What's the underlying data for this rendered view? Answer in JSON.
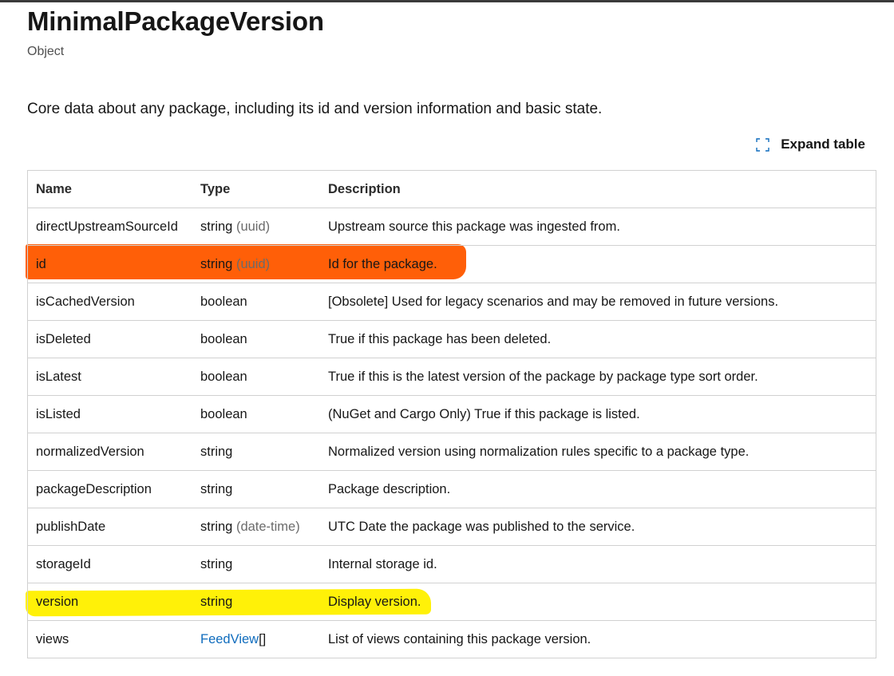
{
  "header": {
    "title": "MinimalPackageVersion",
    "kind": "Object",
    "summary": "Core data about any package, including its id and version information and basic state."
  },
  "toolbar": {
    "expand_label": "Expand table",
    "expand_icon": "expand-icon"
  },
  "table": {
    "columns": [
      "Name",
      "Type",
      "Description"
    ],
    "rows": [
      {
        "name": "directUpstreamSourceId",
        "type": "string",
        "format": "(uuid)",
        "type_is_link": false,
        "description": "Upstream source this package was ingested from."
      },
      {
        "name": "id",
        "type": "string",
        "format": "(uuid)",
        "type_is_link": false,
        "description": "Id for the package.",
        "highlight": "orange"
      },
      {
        "name": "isCachedVersion",
        "type": "boolean",
        "format": "",
        "type_is_link": false,
        "description": "[Obsolete] Used for legacy scenarios and may be removed in future versions."
      },
      {
        "name": "isDeleted",
        "type": "boolean",
        "format": "",
        "type_is_link": false,
        "description": "True if this package has been deleted."
      },
      {
        "name": "isLatest",
        "type": "boolean",
        "format": "",
        "type_is_link": false,
        "description": "True if this is the latest version of the package by package type sort order."
      },
      {
        "name": "isListed",
        "type": "boolean",
        "format": "",
        "type_is_link": false,
        "description": "(NuGet and Cargo Only) True if this package is listed."
      },
      {
        "name": "normalizedVersion",
        "type": "string",
        "format": "",
        "type_is_link": false,
        "description": "Normalized version using normalization rules specific to a package type."
      },
      {
        "name": "packageDescription",
        "type": "string",
        "format": "",
        "type_is_link": false,
        "description": "Package description."
      },
      {
        "name": "publishDate",
        "type": "string",
        "format": "(date-time)",
        "type_is_link": false,
        "description": "UTC Date the package was published to the service."
      },
      {
        "name": "storageId",
        "type": "string",
        "format": "",
        "type_is_link": false,
        "description": "Internal storage id."
      },
      {
        "name": "version",
        "type": "string",
        "format": "",
        "type_is_link": false,
        "description": "Display version.",
        "highlight": "yellow"
      },
      {
        "name": "views",
        "type": "FeedView",
        "format": "[]",
        "type_is_link": true,
        "description": "List of views containing this package version."
      }
    ]
  },
  "colors": {
    "highlight_orange": "#ff5a00",
    "highlight_yellow": "#fff100",
    "link": "#0f6cbd"
  }
}
